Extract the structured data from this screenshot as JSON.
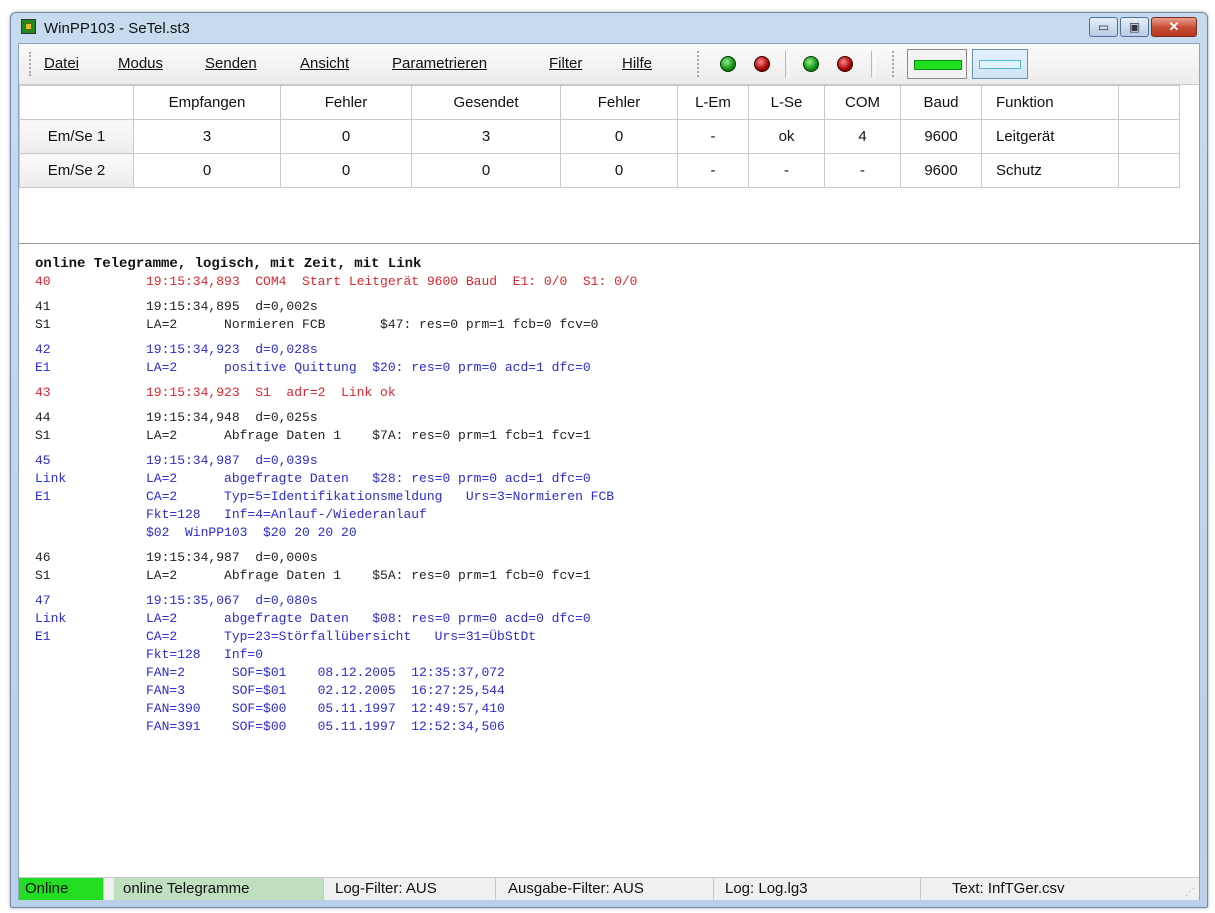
{
  "window": {
    "title": "WinPP103 - SeTel.st3",
    "minimize_label": "▭",
    "maximize_label": "▣",
    "close_label": "✕"
  },
  "menu": [
    "Datei",
    "Modus",
    "Senden",
    "Ansicht",
    "Parametrieren",
    "Filter",
    "Hilfe"
  ],
  "toolbar": {
    "leds": [
      "green",
      "red",
      "green",
      "red"
    ],
    "colors": {
      "green": "#0e8e0e",
      "red": "#a30000",
      "bar_fill": "#1ee11e"
    }
  },
  "stats_table": {
    "headers": [
      "",
      "Empfangen",
      "Fehler",
      "Gesendet",
      "Fehler",
      "L-Em",
      "L-Se",
      "COM",
      "Baud",
      "Funktion",
      ""
    ],
    "rows": [
      [
        "Em/Se 1",
        "3",
        "0",
        "3",
        "0",
        "-",
        "ok",
        "4",
        "9600",
        "Leitgerät",
        ""
      ],
      [
        "Em/Se 2",
        "0",
        "0",
        "0",
        "0",
        "-",
        "-",
        "-",
        "9600",
        "Schutz",
        ""
      ]
    ]
  },
  "log": {
    "header": "online Telegramme, logisch, mit Zeit, mit Link",
    "entries": [
      {
        "color": "red",
        "lines": [
          [
            "40",
            "19:15:34,893  COM4  Start Leitgerät 9600 Baud  E1: 0/0  S1: 0/0"
          ]
        ]
      },
      {
        "color": "black",
        "lines": [
          [
            "41",
            "19:15:34,895  d=0,002s"
          ],
          [
            "S1",
            "LA=2      Normieren FCB       $47: res=0 prm=1 fcb=0 fcv=0"
          ]
        ]
      },
      {
        "color": "blue",
        "lines": [
          [
            "42",
            "19:15:34,923  d=0,028s"
          ],
          [
            "E1",
            "LA=2      positive Quittung  $20: res=0 prm=0 acd=1 dfc=0"
          ]
        ]
      },
      {
        "color": "red",
        "lines": [
          [
            "43",
            "19:15:34,923  S1  adr=2  Link ok"
          ]
        ]
      },
      {
        "color": "black",
        "lines": [
          [
            "44",
            "19:15:34,948  d=0,025s"
          ],
          [
            "S1",
            "LA=2      Abfrage Daten 1    $7A: res=0 prm=1 fcb=1 fcv=1"
          ]
        ]
      },
      {
        "color": "blue",
        "lines": [
          [
            "45",
            "19:15:34,987  d=0,039s"
          ],
          [
            "Link",
            "LA=2      abgefragte Daten   $28: res=0 prm=0 acd=1 dfc=0"
          ],
          [
            "E1",
            "CA=2      Typ=5=Identifikationsmeldung   Urs=3=Normieren FCB"
          ],
          [
            "",
            "Fkt=128   Inf=4=Anlauf-/Wiederanlauf"
          ],
          [
            "",
            "$02  WinPP103  $20 20 20 20"
          ]
        ]
      },
      {
        "color": "black",
        "lines": [
          [
            "46",
            "19:15:34,987  d=0,000s"
          ],
          [
            "S1",
            "LA=2      Abfrage Daten 1    $5A: res=0 prm=1 fcb=0 fcv=1"
          ]
        ]
      },
      {
        "color": "blue",
        "lines": [
          [
            "47",
            "19:15:35,067  d=0,080s"
          ],
          [
            "Link",
            "LA=2      abgefragte Daten   $08: res=0 prm=0 acd=0 dfc=0"
          ],
          [
            "E1",
            "CA=2      Typ=23=Störfallübersicht   Urs=31=ÜbStDt"
          ],
          [
            "",
            "Fkt=128   Inf=0"
          ],
          [
            "",
            "FAN=2      SOF=$01    08.12.2005  12:35:37,072"
          ],
          [
            "",
            "FAN=3      SOF=$01    02.12.2005  16:27:25,544"
          ],
          [
            "",
            "FAN=390    SOF=$00    05.11.1997  12:49:57,410"
          ],
          [
            "",
            "FAN=391    SOF=$00    05.11.1997  12:52:34,506"
          ]
        ]
      }
    ]
  },
  "statusbar": {
    "online": "Online",
    "mode": "online Telegramme",
    "log_filter": "Log-Filter: AUS",
    "output_filter": "Ausgabe-Filter: AUS",
    "log_file": "Log: Log.lg3",
    "text_file": "Text: InfTGer.csv"
  }
}
